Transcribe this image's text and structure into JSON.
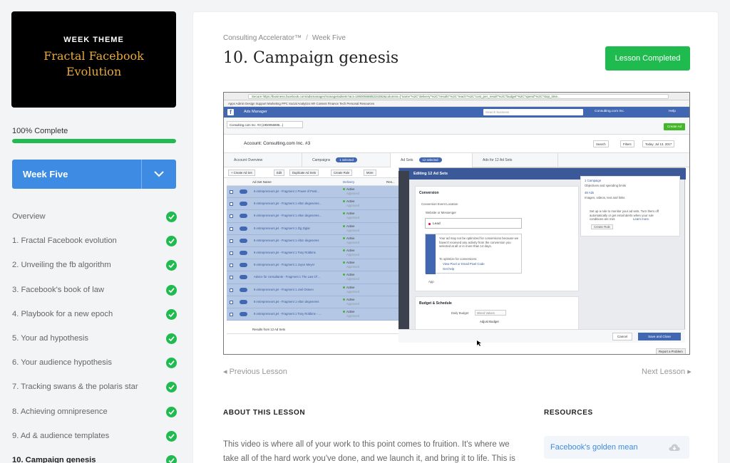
{
  "sidebar": {
    "theme": {
      "label": "WEEK THEME",
      "title_line1": "Fractal Facebook",
      "title_line2": "Evolution"
    },
    "progress": {
      "text": "100% Complete",
      "percent": 100
    },
    "week_select": {
      "label": "Week Five"
    },
    "lessons": [
      {
        "name": "Overview",
        "completed": true
      },
      {
        "name": "1. Fractal Facebook evolution",
        "completed": true
      },
      {
        "name": "2. Unveiling the fb algorithm",
        "completed": true
      },
      {
        "name": "3. Facebook's book of law",
        "completed": true
      },
      {
        "name": "4. Playbook for a new epoch",
        "completed": true
      },
      {
        "name": "5. Your ad hypothesis",
        "completed": true
      },
      {
        "name": "6. Your audience hypothesis",
        "completed": true
      },
      {
        "name": "7. Tracking swans & the polaris star",
        "completed": true
      },
      {
        "name": "8. Achieving omnipresence",
        "completed": true
      },
      {
        "name": "9. Ad & audience templates",
        "completed": true
      },
      {
        "name": "10. Campaign genesis",
        "completed": true,
        "active": true
      }
    ]
  },
  "main": {
    "breadcrumb": {
      "course": "Consulting Accelerator™",
      "sep": "/",
      "section": "Week Five"
    },
    "title": "10. Campaign genesis",
    "completed_button": "Lesson Completed",
    "prev_lesson": "Previous Lesson",
    "next_lesson": "Next Lesson",
    "about_heading": "ABOUT THIS LESSON",
    "about_text": "This video is where all of your work to this point comes to fruition. It's where we take all of the hard work you've done, and we launch it, and bring it to life. This is",
    "resources_heading": "RESOURCES",
    "resources": [
      {
        "label": "Facebook's golden mean"
      }
    ]
  },
  "video": {
    "browser": {
      "url": "Secure  https://business.facebook.com/adsmanager/manage/adsets?act=1950056885234382&columns=[\"name\"%2C\"delivery\"%2C\"results\"%2C\"reach\"%2C\"cost_per_result\"%2C\"budget\"%2C\"spend\"%2C\"stop_time...",
      "bookmarks": "Apps   Admin   Design   Support   Marketing   PPC   Social   Analytics   HR   Content   Finance   Tech   Personal   Resources"
    },
    "topbar": {
      "app": "Ads Manager",
      "search": "Search business",
      "account": "Consulting.com Inc.",
      "help": "Help"
    },
    "account_dropdown": "Consulting.com Inc. #3 (1950056885...)",
    "create_ad": "Create Ad",
    "account_title": "Account: Consulting.com Inc. #3",
    "controls": {
      "search": "Search",
      "filters": "Filters",
      "date": "Today: Jul 13, 2017"
    },
    "tabs": {
      "overview": "Account Overview",
      "campaigns": "Campaigns",
      "campaigns_badge": "1 selected",
      "adsets": "Ad Sets",
      "adsets_badge": "12 selected",
      "ads": "Ads for 12 Ad Sets"
    },
    "toolbar": {
      "create": "+ Create Ad Set",
      "edit": "Edit",
      "duplicate": "Duplicate Ad Sets",
      "rule": "Create Rule",
      "more": "More"
    },
    "table": {
      "col_name": "Ad Set Name",
      "col_delivery": "Delivery",
      "col_results": "Res...",
      "rows": [
        "8 entrepreneurs.jet - Fragment 1 Power of Posit...",
        "8 entrepreneurs.jet - Fragment 1 elton degeneres...",
        "8 entrepreneurs.jet - Fragment 1 elton degeneres...",
        "8 entrepreneurs.jet - Fragment 1 Zig Ziglar",
        "8 entrepreneurs.jet - Fragment 1 elton degeneres",
        "8 entrepreneurs.jet - Fragment 1 Tony Robbins",
        "8 entrepreneurs.jet - Fragment 1 Joyce Meyer",
        "Advice for consultants - Fragment 1 The Law Of ...",
        "8 entrepreneurs.jet - Fragment 1 Joel Osteen",
        "8 entrepreneurs.jet - Fragment 1 elton degeneres",
        "8 entrepreneurs.jet - Fragment 1 Tony Robbins - ..."
      ],
      "status_active": "Active",
      "status_approved": "Approved",
      "results_footer": "Results from 12 Ad Sets"
    },
    "panel": {
      "title": "Editing 12 Ad Sets",
      "conversion_heading": "Conversion",
      "event_location_label": "Conversion Event Location",
      "website_option": "Website or Messenger",
      "lead_value": "Lead",
      "warning_text": "Your ad may not be optimized for conversions because we haven't received any activity from the conversion you selected at all or in more than 14 days.",
      "optimize_label": "To optimize for conversions:",
      "optimize_link1": "View Pixel or Email Pixel Code",
      "optimize_link2": "Get help",
      "app_label": "App",
      "budget_heading": "Budget & Schedule",
      "daily_budget_label": "Daily Budget",
      "daily_budget_value": "Mixed Values",
      "adjust_budget": "Adjust Budget",
      "cancel": "Cancel",
      "save": "Save and Close"
    },
    "right_card": {
      "campaign": "1 Campaign",
      "campaign_sub": "Objectives and spending limits",
      "ads": "48 Ads",
      "ads_sub": "Images, videos, text and links",
      "rule_text": "Set up a rule to monitor your ad sets. Turn them off automatically or get email alerts when your rule conditions are met.",
      "rule_link": "Learn more.",
      "rule_button": "Create Rule"
    },
    "report_problem": "Report a Problem"
  },
  "colors": {
    "accent_blue": "#3d8be3",
    "success_green": "#1fbb4f",
    "theme_gold": "#e8a93e",
    "fb_blue": "#4267b2"
  }
}
